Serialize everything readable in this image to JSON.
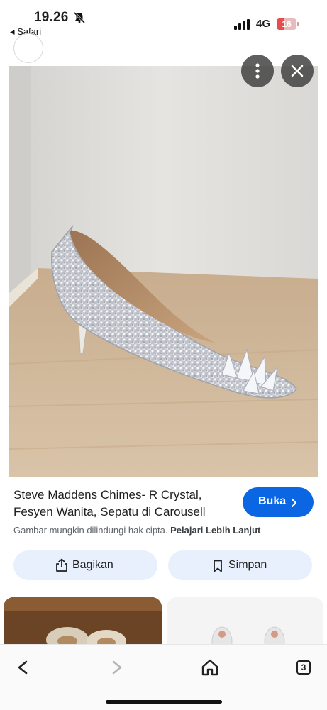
{
  "status_bar": {
    "time": "19.26",
    "back_app": "◂ Safari",
    "network": "4G",
    "battery": "16"
  },
  "product": {
    "title_line1": "Steve Maddens Chimes- R Crystal,",
    "title_line2": "Fesyen Wanita, Sepatu di Carousell",
    "visit_label": "Buka",
    "copyright_text": "Gambar mungkin dilindungi hak cipta.",
    "learn_more": "Pelajari Lebih Lanjut",
    "share_label": "Bagikan",
    "save_label": "Simpan"
  },
  "bottom_nav": {
    "tabs_count": "3"
  },
  "colors": {
    "accent": "#0b66e4",
    "action_bg": "#e8f0fe"
  },
  "icons": [
    "bell-slash-icon",
    "signal-icon",
    "battery-icon",
    "more-vertical-icon",
    "close-icon",
    "chevron-right-icon",
    "share-icon",
    "bookmark-icon",
    "back-icon",
    "forward-icon",
    "home-icon",
    "tabs-icon"
  ]
}
